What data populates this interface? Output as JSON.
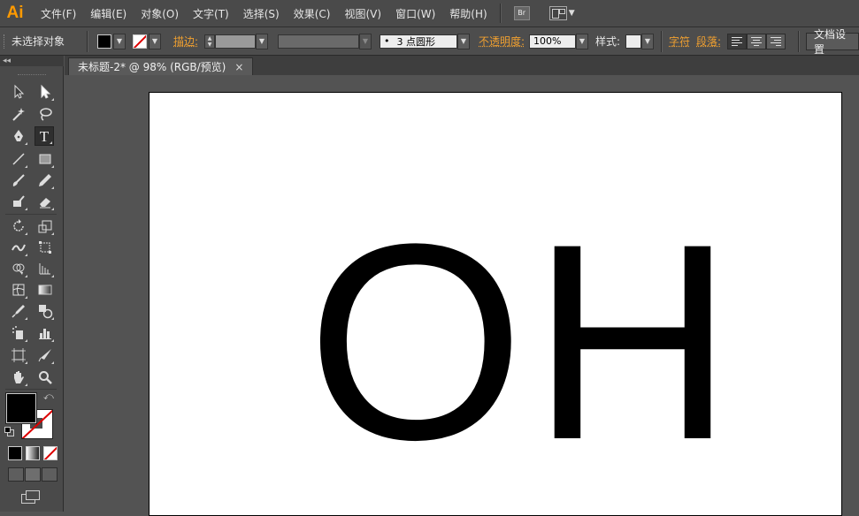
{
  "app": {
    "logo": "Ai"
  },
  "menu": {
    "items": [
      "文件(F)",
      "编辑(E)",
      "对象(O)",
      "文字(T)",
      "选择(S)",
      "效果(C)",
      "视图(V)",
      "窗口(W)",
      "帮助(H)"
    ],
    "bridge_button": "Br"
  },
  "control": {
    "selection": "未选择对象",
    "stroke_label": "描边:",
    "brush_value": "3 点圆形",
    "brush_dot": "•",
    "opacity_label": "不透明度:",
    "opacity_value": "100%",
    "style_label": "样式:",
    "char_label": "字符",
    "para_label": "段落:",
    "doc_settings": "文档设置"
  },
  "tools_header": "◂◂",
  "document": {
    "tab_title": "未标题-2* @ 98% (RGB/预览)",
    "close": "×",
    "artboard_text": "OH"
  },
  "colors": {
    "accent": "#ff9a00",
    "label_orange": "#f0a030",
    "canvas": "#535353",
    "panel": "#4a4a4a"
  }
}
